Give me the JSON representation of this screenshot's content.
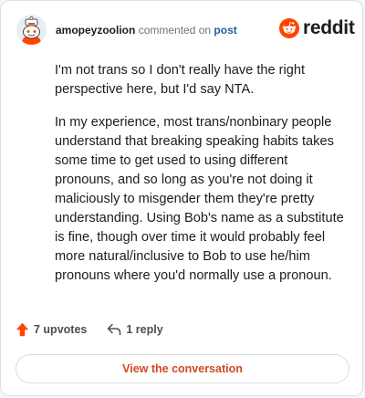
{
  "comment": {
    "author": "amopeyzoolion",
    "action_text": "commented on",
    "post_link": "post",
    "paragraphs": [
      "I'm not trans so I don't really have the right perspective here, but I'd say NTA.",
      "In my experience, most trans/nonbinary people understand that breaking speaking habits takes some time to get used to using different pronouns, and so long as you're not doing it maliciously to misgender them they're pretty understanding. Using Bob's name as a substitute is fine, though over time it would probably feel more natural/inclusive to Bob to use he/him pronouns where you'd normally use a pronoun."
    ]
  },
  "brand": {
    "name": "reddit",
    "icon": "reddit-snoo-icon",
    "accent": "#ff4500"
  },
  "actions": {
    "upvotes_label": "7 upvotes",
    "reply_label": "1 reply",
    "upvote_icon": "upvote-arrow-icon",
    "reply_icon": "reply-arrow-icon",
    "upvote_color": "#ff4500"
  },
  "footer": {
    "view_button_label": "View the conversation"
  }
}
